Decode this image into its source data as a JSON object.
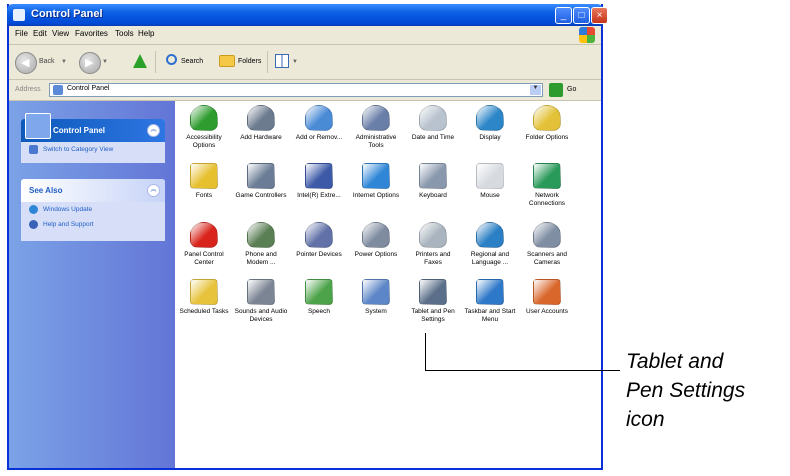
{
  "window": {
    "title": "Control Panel",
    "controls": {
      "minimize": "_",
      "maximize": "□",
      "close": "×"
    }
  },
  "menu": [
    "File",
    "Edit",
    "View",
    "Favorites",
    "Tools",
    "Help"
  ],
  "toolbar": {
    "back_label": "Back",
    "search_label": "Search",
    "folders_label": "Folders"
  },
  "address": {
    "label": "Address",
    "value": "Control Panel",
    "go_label": "Go"
  },
  "left_pane": {
    "main_panel": {
      "title": "Control Panel",
      "link": "Switch to Category View"
    },
    "see_also": {
      "title": "See Also",
      "links": [
        "Windows Update",
        "Help and Support"
      ]
    }
  },
  "items": [
    {
      "label": "Accessibility Options",
      "icon": "accessibility-icon",
      "color": "#2e9c2e"
    },
    {
      "label": "Add Hardware",
      "icon": "add-hardware-icon",
      "color": "#6d7b8f"
    },
    {
      "label": "Add or Remov...",
      "icon": "add-remove-programs-icon",
      "color": "#4a8bd6"
    },
    {
      "label": "Administrative Tools",
      "icon": "administrative-tools-icon",
      "color": "#6a7fa8"
    },
    {
      "label": "Date and Time",
      "icon": "date-time-icon",
      "color": "#b9c3cf"
    },
    {
      "label": "Display",
      "icon": "display-icon",
      "color": "#2c86c8"
    },
    {
      "label": "Folder Options",
      "icon": "folder-options-icon",
      "color": "#e3c23a"
    },
    {
      "label": "Fonts",
      "icon": "fonts-icon",
      "color": "#e6c02f"
    },
    {
      "label": "Game Controllers",
      "icon": "game-controllers-icon",
      "color": "#6b7d96"
    },
    {
      "label": "Intel(R) Extre...",
      "icon": "intel-graphics-icon",
      "color": "#3d5aa8"
    },
    {
      "label": "Internet Options",
      "icon": "internet-options-icon",
      "color": "#2f86d6"
    },
    {
      "label": "Keyboard",
      "icon": "keyboard-icon",
      "color": "#8a98ae"
    },
    {
      "label": "Mouse",
      "icon": "mouse-icon",
      "color": "#d7dbe0"
    },
    {
      "label": "Network Connections",
      "icon": "network-connections-icon",
      "color": "#2a9a5a"
    },
    {
      "label": "Panel Control Center",
      "icon": "panel-control-center-icon",
      "color": "#d8241c"
    },
    {
      "label": "Phone and Modem ...",
      "icon": "phone-modem-icon",
      "color": "#5b7f55"
    },
    {
      "label": "Pointer Devices",
      "icon": "pointer-devices-icon",
      "color": "#6272a8"
    },
    {
      "label": "Power Options",
      "icon": "power-options-icon",
      "color": "#7f8ca0"
    },
    {
      "label": "Printers and Faxes",
      "icon": "printers-faxes-icon",
      "color": "#aab4bf"
    },
    {
      "label": "Regional and Language ...",
      "icon": "regional-language-icon",
      "color": "#2b7fc4"
    },
    {
      "label": "Scanners and Cameras",
      "icon": "scanners-cameras-icon",
      "color": "#7f8ea3"
    },
    {
      "label": "Scheduled Tasks",
      "icon": "scheduled-tasks-icon",
      "color": "#e7c33b"
    },
    {
      "label": "Sounds and Audio Devices",
      "icon": "sounds-audio-icon",
      "color": "#7c8594"
    },
    {
      "label": "Speech",
      "icon": "speech-icon",
      "color": "#4da34a"
    },
    {
      "label": "System",
      "icon": "system-icon",
      "color": "#5c86c7"
    },
    {
      "label": "Tablet and Pen Settings",
      "icon": "tablet-pen-icon",
      "color": "#5c6f8a"
    },
    {
      "label": "Taskbar and Start Menu",
      "icon": "taskbar-start-menu-icon",
      "color": "#2d78c8"
    },
    {
      "label": "User Accounts",
      "icon": "user-accounts-icon",
      "color": "#d9662a"
    }
  ],
  "callout": {
    "text": "Tablet and\nPen Settings\nicon"
  }
}
